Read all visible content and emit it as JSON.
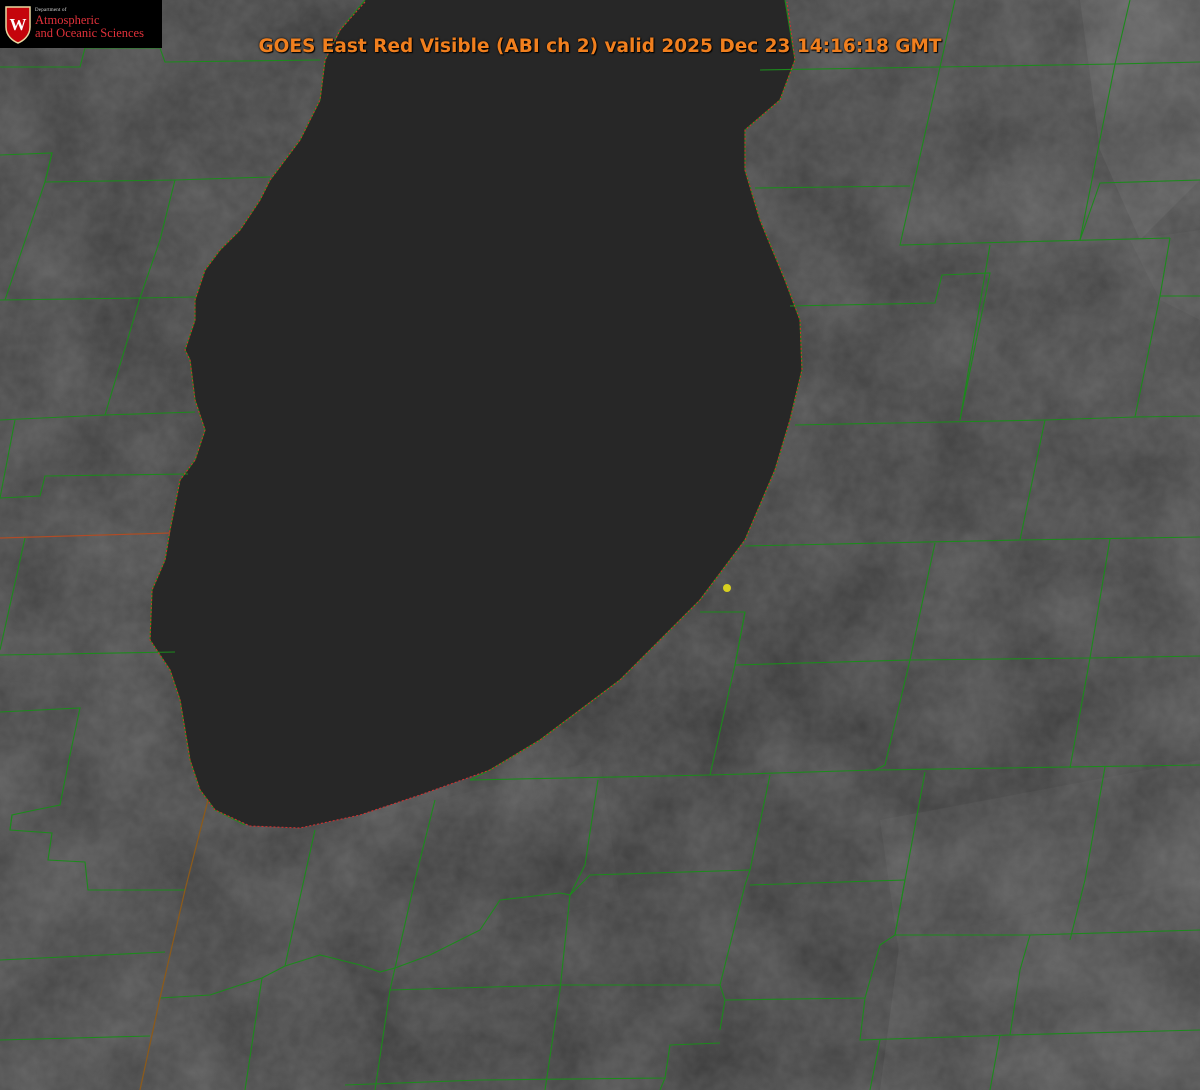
{
  "title": "GOES East Red Visible (ABI ch 2) valid 2025 Dec 23 14:16:18 GMT",
  "logo": {
    "department": "Department of",
    "line1": "Atmospheric",
    "line2": "and Oceanic Sciences",
    "seal_letter": "W"
  },
  "colors": {
    "title": "#f07f1e",
    "county_lines": "#1c8a1c",
    "shoreline": "#d03030",
    "marker": "#d8d020",
    "land": "#363636",
    "lake": "#272727",
    "logo_red": "#c5050c"
  },
  "layers": [
    "satellite-imagery",
    "county-boundaries",
    "state-boundaries",
    "shoreline",
    "station-marker"
  ]
}
